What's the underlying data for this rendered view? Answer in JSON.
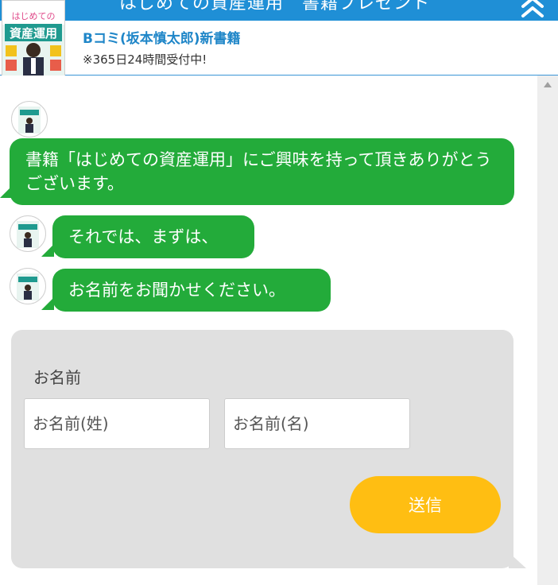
{
  "header": {
    "title": "はじめての資産運用　書籍プレゼント",
    "collapse_icon": "chevron-double-up-icon",
    "bar_color": "#1f8fd6"
  },
  "book": {
    "cover_text_top": "はじめての",
    "cover_text_main": "資産運用",
    "name": "Bコミ(坂本慎太郎)新書籍",
    "availability": "※365日24時間受付中!"
  },
  "messages": [
    {
      "text": "書籍「はじめての資産運用」にご興味を持って頂きありがとうございます。"
    },
    {
      "text": "それでは、まずは、"
    },
    {
      "text": "お名前をお聞かせください。"
    }
  ],
  "form": {
    "label": "お名前",
    "last_name_placeholder": "お名前(姓)",
    "first_name_placeholder": "お名前(名)",
    "submit_label": "送信"
  },
  "colors": {
    "bubble": "#23ab3a",
    "submit": "#ffbe12",
    "form_background": "#e0e0e0"
  }
}
